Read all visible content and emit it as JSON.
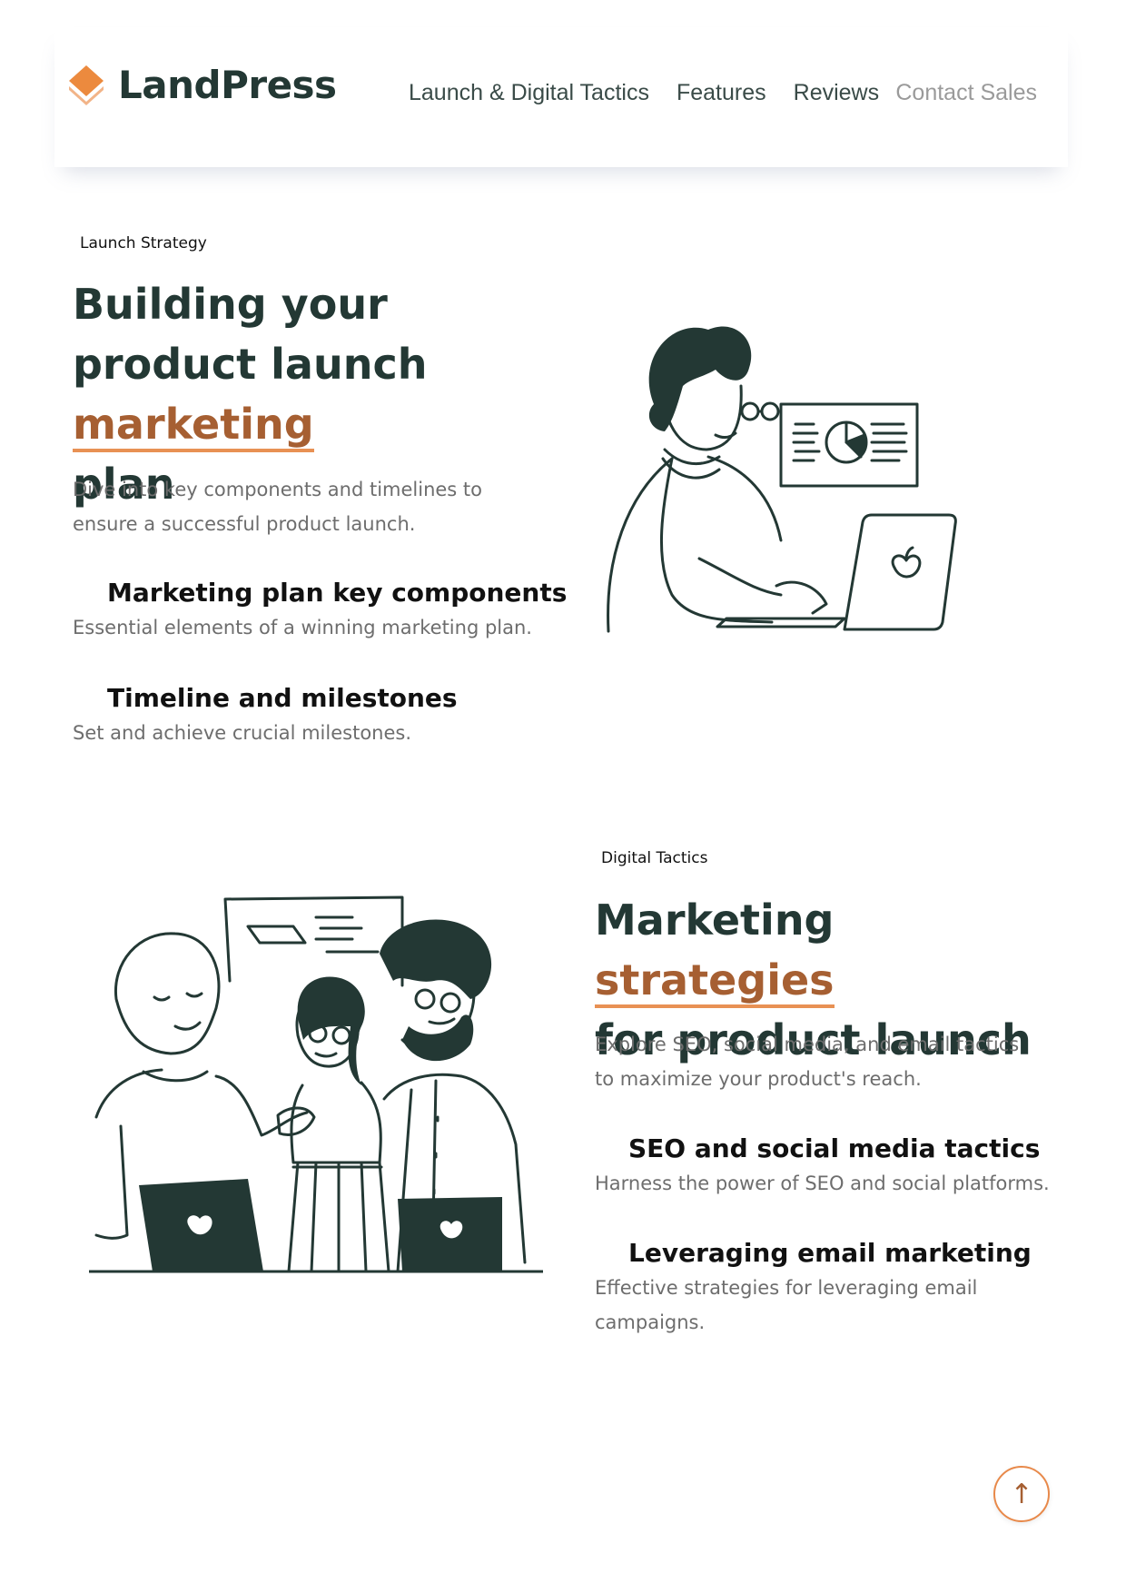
{
  "brand": {
    "name": "LandPress"
  },
  "nav": {
    "items": [
      "Launch & Digital Tactics",
      "Features",
      "Reviews"
    ],
    "contact": "Contact Sales"
  },
  "section1": {
    "eyebrow": "Launch Strategy",
    "heading_pre": "Building your product launch ",
    "heading_highlight": "marketing",
    "heading_post": "plan",
    "lead": "Dive into key components and timelines to ensure a successful product launch.",
    "features": [
      {
        "title": "Marketing plan key components",
        "desc": "Essential elements of a winning marketing plan."
      },
      {
        "title": "Timeline and milestones",
        "desc": "Set and achieve crucial milestones."
      }
    ]
  },
  "section2": {
    "eyebrow": "Digital Tactics",
    "heading_pre": "Marketing ",
    "heading_highlight": "strategies",
    "heading_post": "for product launch",
    "lead": "Explore SEO, social media, and email tactics to maximize your product's reach.",
    "features": [
      {
        "title": "SEO and social media tactics",
        "desc": "Harness the power of SEO and social platforms."
      },
      {
        "title": "Leveraging email marketing",
        "desc": "Effective strategies for leveraging email campaigns."
      }
    ]
  },
  "scroll_top": {
    "icon": "arrow-up-icon",
    "glyph": "↑"
  },
  "colors": {
    "dark": "#233834",
    "accent": "#a65f32",
    "underline": "#e89154",
    "muted": "#6d6d6d"
  }
}
